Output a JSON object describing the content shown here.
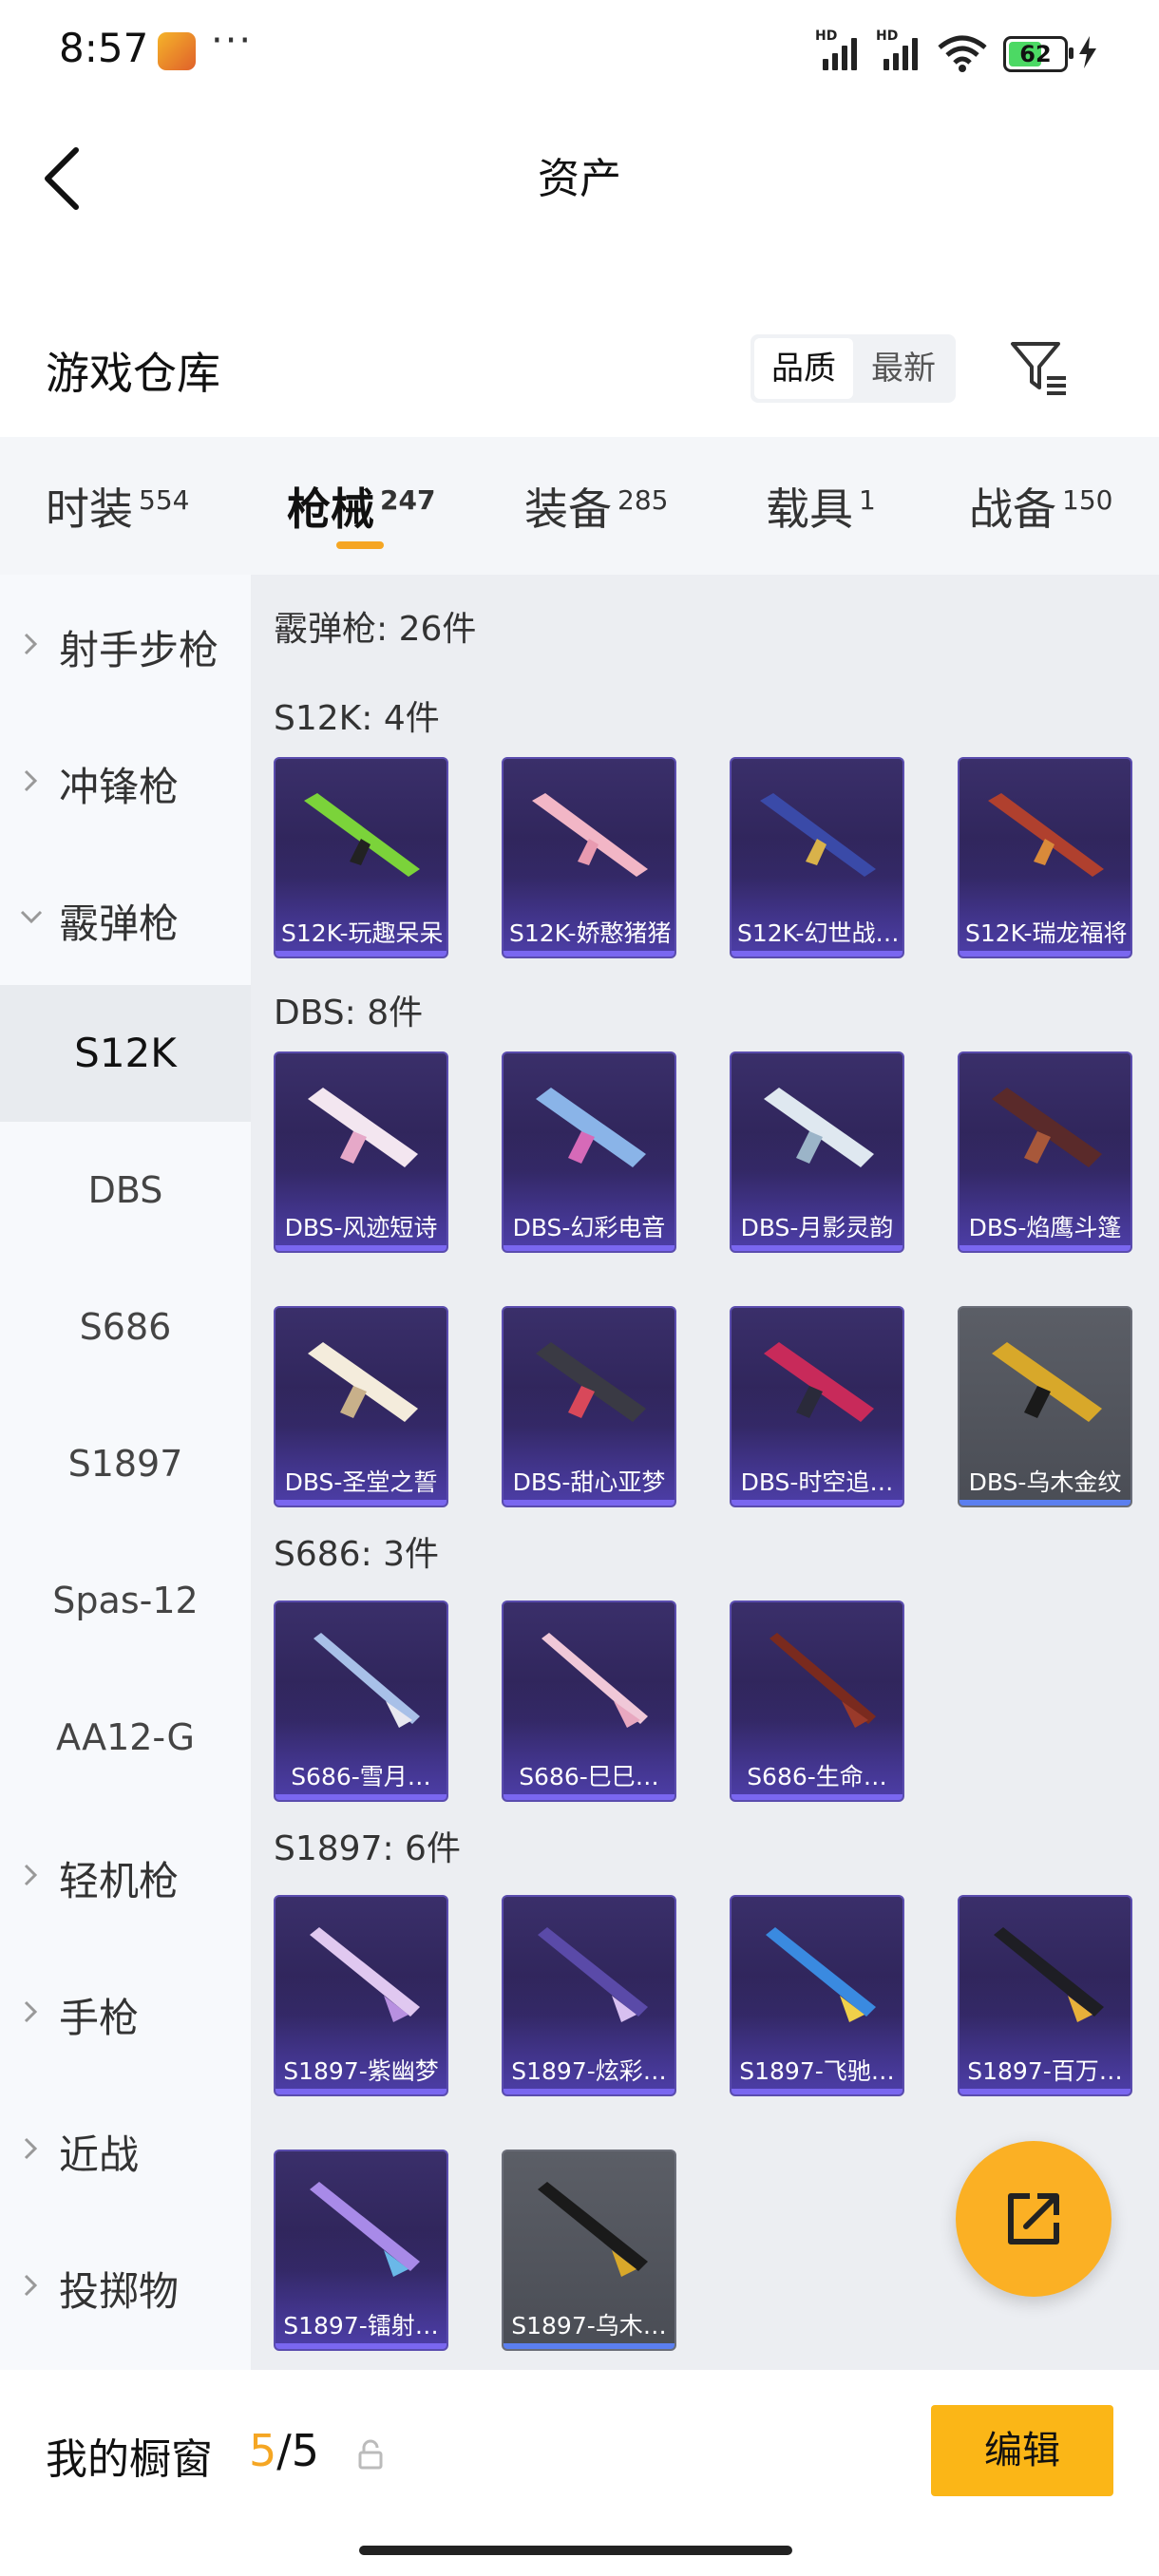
{
  "status_bar": {
    "time": "8:57",
    "more": "···",
    "battery": "62"
  },
  "header": {
    "title": "资产"
  },
  "warehouse": {
    "title": "游戏仓库",
    "sort_quality": "品质",
    "sort_newest": "最新"
  },
  "tabs": [
    {
      "label": "时装",
      "count": "554"
    },
    {
      "label": "枪械",
      "count": "247"
    },
    {
      "label": "装备",
      "count": "285"
    },
    {
      "label": "载具",
      "count": "1"
    },
    {
      "label": "战备",
      "count": "150"
    }
  ],
  "sidebar": {
    "items": [
      {
        "label": "射手步枪"
      },
      {
        "label": "冲锋枪"
      },
      {
        "label": "霰弹枪"
      },
      {
        "label": "S12K"
      },
      {
        "label": "DBS"
      },
      {
        "label": "S686"
      },
      {
        "label": "S1897"
      },
      {
        "label": "Spas-12"
      },
      {
        "label": "AA12-G"
      },
      {
        "label": "轻机枪"
      },
      {
        "label": "手枪"
      },
      {
        "label": "近战"
      },
      {
        "label": "投掷物"
      }
    ]
  },
  "content": {
    "category_label": "霰弹枪: 26件",
    "groups": [
      {
        "label": "S12K: 4件",
        "items": [
          "S12K-玩趣呆呆",
          "S12K-娇憨猪猪",
          "S12K-幻世战…",
          "S12K-瑞龙福将"
        ]
      },
      {
        "label": "DBS: 8件",
        "items": [
          "DBS-风迹短诗",
          "DBS-幻彩电音",
          "DBS-月影灵韵",
          "DBS-焰鹰斗篷",
          "DBS-圣堂之誓",
          "DBS-甜心亚梦",
          "DBS-时空追…",
          "DBS-乌木金纹"
        ]
      },
      {
        "label": "S686: 3件",
        "items": [
          "S686-雪月…",
          "S686-巳巳…",
          "S686-生命…"
        ]
      },
      {
        "label": "S1897: 6件",
        "items": [
          "S1897-紫幽梦",
          "S1897-炫彩…",
          "S1897-飞驰…",
          "S1897-百万…",
          "S1897-镭射…",
          "S1897-乌木…"
        ]
      }
    ]
  },
  "bottom": {
    "showcase_label": "我的橱窗",
    "showcase_current": "5",
    "showcase_total": "/5",
    "edit_label": "编辑"
  },
  "colors": {
    "accent": "#f5a623",
    "card_purple": "#2c2256",
    "card_gray": "#4a4d55"
  }
}
